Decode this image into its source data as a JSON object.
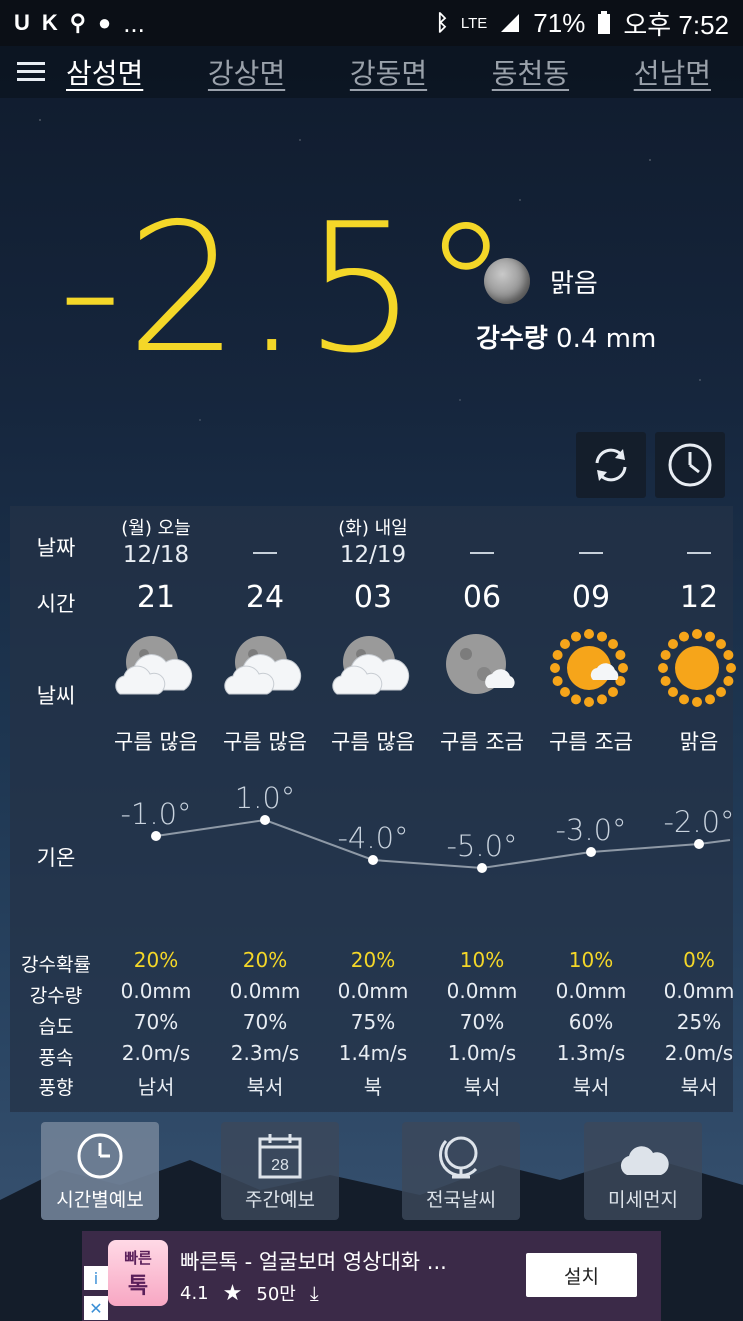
{
  "status_bar": {
    "battery": "71%",
    "network": "LTE",
    "time": "오후 7:52",
    "notif_more": "..."
  },
  "tabs": [
    "삼성면",
    "강상면",
    "강동면",
    "동천동",
    "선남면"
  ],
  "current": {
    "temperature": "-2.5°",
    "condition": "맑음",
    "precip_label": "강수량",
    "precip_value": "0.4 mm"
  },
  "forecast": {
    "labels": {
      "date": "날짜",
      "time": "시간",
      "weather": "날씨",
      "temp": "기온",
      "precip_prob": "강수확률",
      "precip_amt": "강수량",
      "humidity": "습도",
      "wind_speed": "풍속",
      "wind_dir": "풍향"
    },
    "columns": [
      {
        "day": "(월) 오늘",
        "date": "12/18",
        "hour": "21",
        "icon": "cloudy-night-icon",
        "cond": "구름 많음",
        "temp": "-1.0°",
        "temp_value": -1.0,
        "prob": "20%",
        "amt": "0.0mm",
        "hum": "70%",
        "wind": "2.0m/s",
        "dir": "남서"
      },
      {
        "day": "",
        "date": "",
        "hour": "24",
        "icon": "cloudy-night-icon",
        "cond": "구름 많음",
        "temp": "1.0°",
        "temp_value": 1.0,
        "prob": "20%",
        "amt": "0.0mm",
        "hum": "70%",
        "wind": "2.3m/s",
        "dir": "북서"
      },
      {
        "day": "(화) 내일",
        "date": "12/19",
        "hour": "03",
        "icon": "cloudy-night-icon",
        "cond": "구름 많음",
        "temp": "-4.0°",
        "temp_value": -4.0,
        "prob": "20%",
        "amt": "0.0mm",
        "hum": "75%",
        "wind": "1.4m/s",
        "dir": "북"
      },
      {
        "day": "",
        "date": "",
        "hour": "06",
        "icon": "moon-cloud-icon",
        "cond": "구름 조금",
        "temp": "-5.0°",
        "temp_value": -5.0,
        "prob": "10%",
        "amt": "0.0mm",
        "hum": "70%",
        "wind": "1.0m/s",
        "dir": "북서"
      },
      {
        "day": "",
        "date": "",
        "hour": "09",
        "icon": "sun-cloud-icon",
        "cond": "구름 조금",
        "temp": "-3.0°",
        "temp_value": -3.0,
        "prob": "10%",
        "amt": "0.0mm",
        "hum": "60%",
        "wind": "1.3m/s",
        "dir": "북서"
      },
      {
        "day": "",
        "date": "",
        "hour": "12",
        "icon": "sun-icon",
        "cond": "맑음",
        "temp": "-2.0°",
        "temp_value": -2.0,
        "prob": "0%",
        "amt": "0.0mm",
        "hum": "25%",
        "wind": "2.0m/s",
        "dir": "북서"
      }
    ]
  },
  "bottom_nav": [
    {
      "label": "시간별예보",
      "icon": "clock-icon",
      "active": true
    },
    {
      "label": "주간예보",
      "icon": "calendar-icon",
      "calendar_day": "28",
      "active": false
    },
    {
      "label": "전국날씨",
      "icon": "globe-icon",
      "active": false
    },
    {
      "label": "미세먼지",
      "icon": "cloud-icon",
      "active": false
    }
  ],
  "ad": {
    "logo_line1": "빠른",
    "logo_line2": "톡",
    "title": "빠른톡 - 얼굴보며 영상대화 ...",
    "rating": "4.1",
    "downloads": "50만",
    "install": "설치"
  },
  "colors": {
    "accent_yellow": "#f4d728",
    "panel": "#243246"
  }
}
